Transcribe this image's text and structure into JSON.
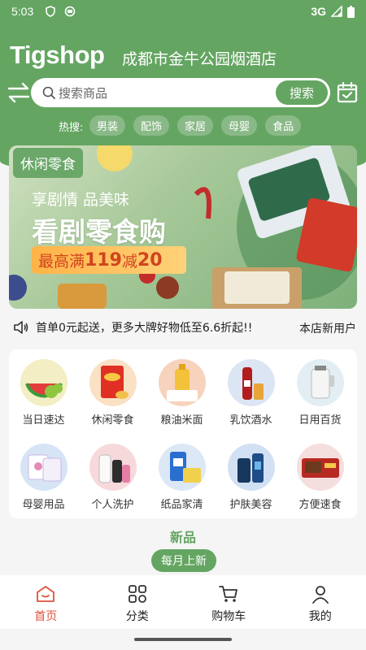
{
  "status_bar": {
    "time": "5:03",
    "network": "3G"
  },
  "header": {
    "logo": "Tigshop",
    "store_name": "成都市金牛公园烟酒店",
    "search_placeholder": "搜索商品",
    "search_button": "搜索",
    "hot_label": "热搜:",
    "hot_tags": [
      "男装",
      "配饰",
      "家居",
      "母婴",
      "食品"
    ]
  },
  "banner": {
    "tag": "休闲零食",
    "line1": "享剧情 品美味",
    "line2": "看剧零食购",
    "promo_prefix": "最高满",
    "promo_amount1": "119",
    "promo_mid": "减",
    "promo_amount2": "20"
  },
  "notice": {
    "text": "首单0元起送，更多大牌好物低至6.6折起!!",
    "right": "本店新用户"
  },
  "categories": [
    {
      "label": "当日速达"
    },
    {
      "label": "休闲零食"
    },
    {
      "label": "粮油米面"
    },
    {
      "label": "乳饮酒水"
    },
    {
      "label": "日用百货"
    },
    {
      "label": "母婴用品"
    },
    {
      "label": "个人洗护"
    },
    {
      "label": "纸品家清"
    },
    {
      "label": "护肤美容"
    },
    {
      "label": "方便速食"
    }
  ],
  "new_section": {
    "title": "新品",
    "pill": "每月上新"
  },
  "bottom_nav": [
    {
      "label": "首页",
      "icon": "home-icon"
    },
    {
      "label": "分类",
      "icon": "category-icon"
    },
    {
      "label": "购物车",
      "icon": "cart-icon"
    },
    {
      "label": "我的",
      "icon": "user-icon"
    }
  ],
  "colors": {
    "primary": "#64a562",
    "active_nav": "#e0513a",
    "promo_text": "#d0441f"
  }
}
